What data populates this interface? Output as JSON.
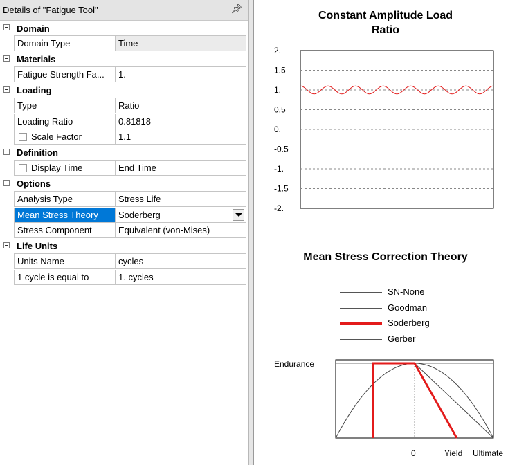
{
  "panel": {
    "title": "Details of \"Fatigue Tool\"",
    "pin_icon": "pin-icon"
  },
  "groups": {
    "domain": "Domain",
    "materials": "Materials",
    "loading": "Loading",
    "definition": "Definition",
    "options": "Options",
    "life_units": "Life Units"
  },
  "props": {
    "domain_type": {
      "label": "Domain Type",
      "value": "Time"
    },
    "fatigue_strength_factor": {
      "label": "Fatigue Strength Fa...",
      "value": "1."
    },
    "type": {
      "label": "Type",
      "value": "Ratio"
    },
    "loading_ratio": {
      "label": "Loading Ratio",
      "value": "0.81818"
    },
    "scale_factor": {
      "label": "Scale Factor",
      "value": "1.1"
    },
    "display_time": {
      "label": "Display Time",
      "value": "End Time"
    },
    "analysis_type": {
      "label": "Analysis Type",
      "value": "Stress Life"
    },
    "mean_stress_theory": {
      "label": "Mean Stress Theory",
      "value": "Soderberg"
    },
    "stress_component": {
      "label": "Stress Component",
      "value": "Equivalent (von-Mises)"
    },
    "units_name": {
      "label": "Units Name",
      "value": "cycles"
    },
    "cycle_equal": {
      "label": "1 cycle is equal to",
      "value": "1. cycles"
    }
  },
  "load_chart": {
    "title_line1": "Constant Amplitude Load",
    "title_line2": "Ratio",
    "y_ticks": [
      "2.",
      "1.5",
      "1.",
      "0.5",
      "0.",
      "-0.5",
      "-1.",
      "-1.5",
      "-2."
    ]
  },
  "mean_chart": {
    "title": "Mean Stress Correction Theory",
    "legend": [
      "SN-None",
      "Goodman",
      "Soderberg",
      "Gerber"
    ],
    "active": "Soderberg",
    "y_label": "Endurance",
    "x_labels": [
      "0",
      "Yield",
      "Ultimate"
    ]
  },
  "colors": {
    "selection": "#0078d7",
    "curve": "#e31b1b"
  },
  "chart_data": [
    {
      "type": "line",
      "title": "Constant Amplitude Load Ratio",
      "xlabel": "",
      "ylabel": "",
      "ylim": [
        -2,
        2
      ],
      "yticks": [
        2,
        1.5,
        1,
        0.5,
        0,
        -0.5,
        -1,
        -1.5,
        -2
      ],
      "grid": "horizontal dashed",
      "series": [
        {
          "mean": 1.0,
          "amplitude": 0.1,
          "cycles": 7
        }
      ]
    },
    {
      "type": "line",
      "title": "Mean Stress Correction Theory",
      "ylabel": "Endurance",
      "x_tick_labels": [
        "0",
        "Yield",
        "Ultimate"
      ],
      "series": [
        {
          "name": "SN-None"
        },
        {
          "name": "Goodman"
        },
        {
          "name": "Soderberg"
        },
        {
          "name": "Gerber"
        }
      ]
    }
  ]
}
